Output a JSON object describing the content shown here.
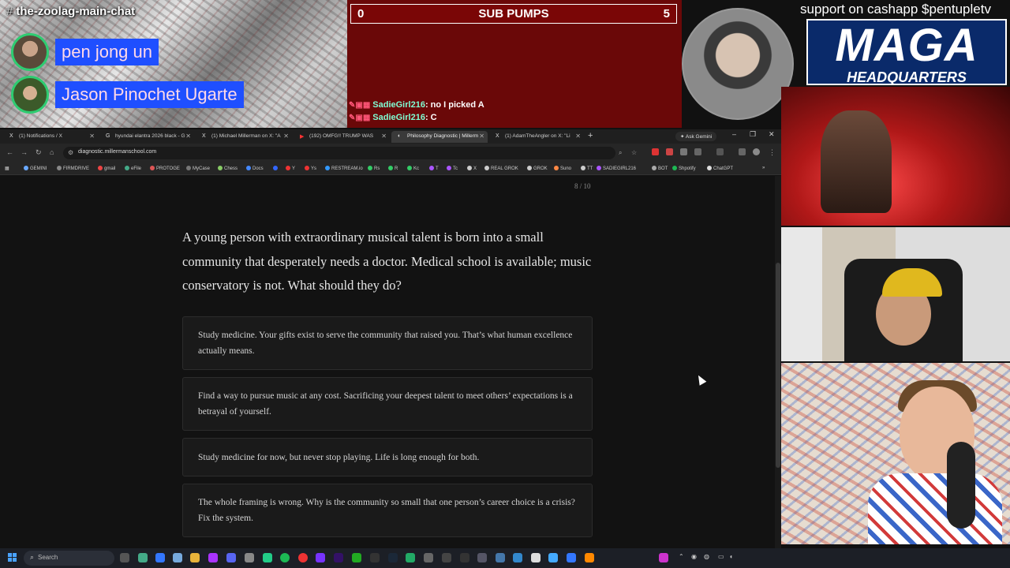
{
  "overlay": {
    "channel": "the-zoolag-main-chat",
    "speakers": [
      "pen jong un",
      "Jason Pinochet Ugarte"
    ],
    "score": {
      "left": "0",
      "title": "SUB PUMPS",
      "right": "5"
    },
    "chat": [
      {
        "user": "SadieGirl216",
        "message": ": no I picked A"
      },
      {
        "user": "SadieGirl216",
        "message": ": C"
      }
    ],
    "cashapp": "support on cashapp $pentupletv",
    "maga_big": "MAGA",
    "maga_small": "HEADQUARTERS"
  },
  "browser": {
    "tabs": [
      {
        "icon": "X",
        "label": "(1) Notifications / X"
      },
      {
        "icon": "G",
        "label": "hyundai elantra 2026 black - G"
      },
      {
        "icon": "X",
        "label": "(1) Michael Millerman on X: \"A"
      },
      {
        "icon": "▶",
        "label": "(192) OMFG!! TRUMP WAS"
      },
      {
        "icon": "◐",
        "label": "Philosophy Diagnostic | Millerm"
      },
      {
        "icon": "X",
        "label": "(1) AdamTheAngler on X: \"Li"
      }
    ],
    "new_tab": "+",
    "ask_gemini": "Ask Gemini",
    "url": "diagnostic.millermanschool.com",
    "bookmarks": [
      "GEMINI",
      "FIRMDRIVE",
      "gmail",
      "eFile",
      "PROTOGE",
      "MyCase",
      "Chess",
      "Docs",
      "Y",
      "Ys",
      "RESTREAM.io",
      "Rs",
      "R",
      "Kc",
      "T",
      "Tc",
      "X",
      "REAL GROK",
      "GROK",
      "Suno",
      "TT",
      "SADIEGIRL216",
      "BOT",
      "Shpotify",
      "ChatGPT"
    ]
  },
  "quiz": {
    "progress": "8 / 10",
    "question": "A young person with extraordinary musical talent is born into a small community that desperately needs a doctor. Medical school is available; music conservatory is not. What should they do?",
    "options": [
      "Study medicine. Your gifts exist to serve the community that raised you. That’s what human excellence actually means.",
      "Find a way to pursue music at any cost. Sacrificing your deepest talent to meet others’ expectations is a betrayal of yourself.",
      "Study medicine for now, but never stop playing. Life is long enough for both.",
      "The whole framing is wrong. Why is the community so small that one person’s career choice is a crisis? Fix the system."
    ]
  },
  "taskbar": {
    "search": "Search"
  }
}
